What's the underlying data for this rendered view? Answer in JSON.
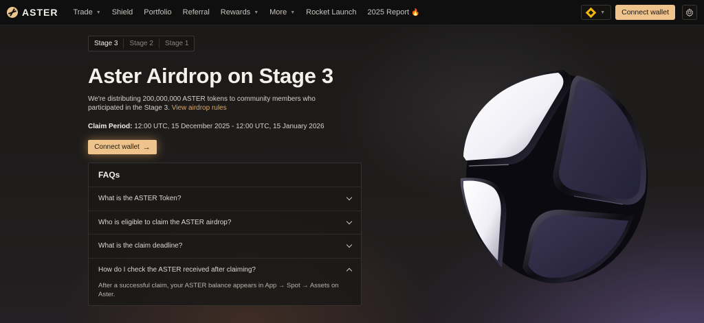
{
  "nav": {
    "brand": "ASTER",
    "items": [
      {
        "label": "Trade",
        "dropdown": true
      },
      {
        "label": "Shield",
        "dropdown": false
      },
      {
        "label": "Portfolio",
        "dropdown": false
      },
      {
        "label": "Referral",
        "dropdown": false
      },
      {
        "label": "Rewards",
        "dropdown": true
      },
      {
        "label": "More",
        "dropdown": true
      },
      {
        "label": "Rocket Launch",
        "dropdown": false
      },
      {
        "label": "2025 Report",
        "dropdown": false
      }
    ],
    "connect_label": "Connect wallet",
    "chain_icon": "bnb-chain-icon",
    "settings_icon": "gear-icon"
  },
  "stages": [
    "Stage 3",
    "Stage 2",
    "Stage 1"
  ],
  "hero": {
    "title": "Aster Airdrop on Stage 3",
    "description": "We're distributing 200,000,000 ASTER tokens to community members who participated in the Stage 3.",
    "rules_link": "View airdrop rules",
    "claim_label": "Claim Period:",
    "claim_value": "12:00 UTC, 15 December 2025 - 12:00 UTC, 15 January 2026",
    "connect_label": "Connect wallet"
  },
  "faq": {
    "title": "FAQs",
    "items": [
      {
        "question": "What is the ASTER Token?",
        "expanded": false
      },
      {
        "question": "Who is eligible to claim the ASTER airdrop?",
        "expanded": false
      },
      {
        "question": "What is the claim deadline?",
        "expanded": false
      },
      {
        "question": "How do I check the ASTER received after claiming?",
        "expanded": true,
        "answer": "After a successful claim, your ASTER balance appears in App → Spot → Assets on Aster."
      }
    ]
  },
  "colors": {
    "accent": "#efc38c",
    "link": "#d9a86b",
    "background": "#1b1a19"
  }
}
